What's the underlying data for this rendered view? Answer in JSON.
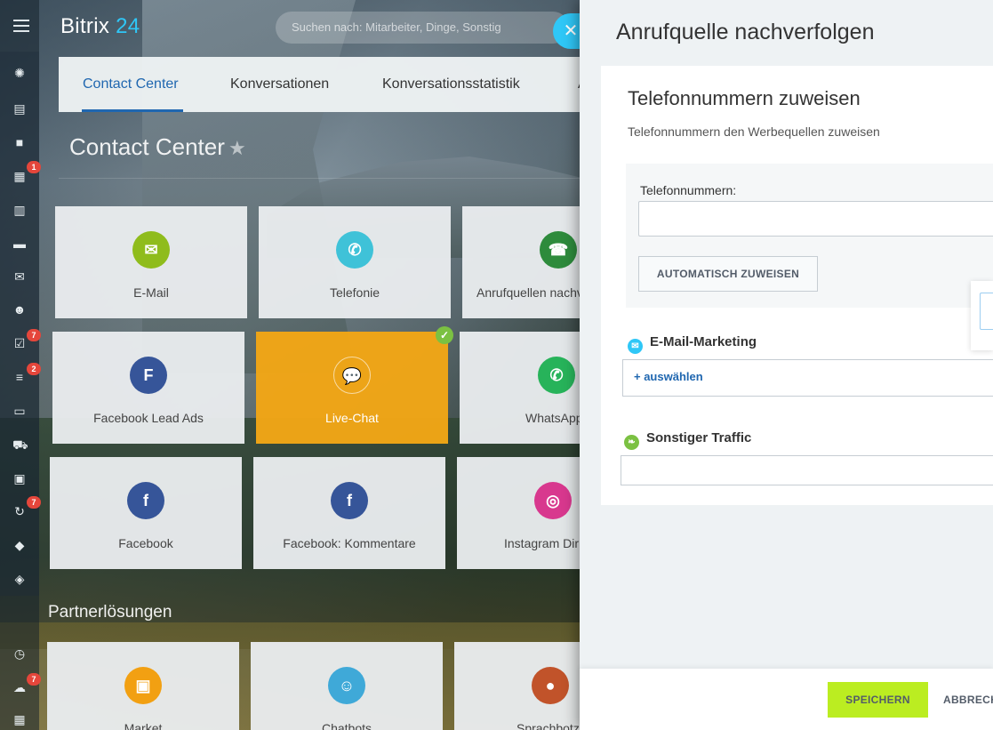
{
  "header": {
    "logo_text": "Bitrix",
    "logo_num": "24",
    "search_placeholder": "Suchen nach: Mitarbeiter, Dinge, Sonstig",
    "close_symbol": "✕"
  },
  "rail": {
    "badges": [
      "1",
      "7",
      "2",
      "7",
      "7"
    ]
  },
  "tabs": [
    {
      "label": "Contact Center",
      "active": true
    },
    {
      "label": "Konversationen",
      "active": false
    },
    {
      "label": "Konversationsstatistik",
      "active": false
    },
    {
      "label": "Ar",
      "active": false
    }
  ],
  "page": {
    "title": "Contact Center",
    "star": "★",
    "partner_title": "Partnerlösungen"
  },
  "tiles": [
    {
      "label": "E-Mail",
      "icon": "mail-icon",
      "glyph": "✉",
      "color": "#8fbc1c"
    },
    {
      "label": "Telefonie",
      "icon": "phone-icon",
      "glyph": "✆",
      "color": "#3fc2d8"
    },
    {
      "label": "Anrufquellen nachve",
      "icon": "phone-track-icon",
      "glyph": "☎",
      "color": "#2e8b3c"
    },
    {
      "label": "Facebook Lead Ads",
      "icon": "facebook-leads-icon",
      "glyph": "F",
      "color": "#365599"
    },
    {
      "label": "Live-Chat",
      "icon": "chat-icon",
      "glyph": "💬",
      "color": "transparent"
    },
    {
      "label": "WhatsApp",
      "icon": "whatsapp-icon",
      "glyph": "✆",
      "color": "#27b35a"
    },
    {
      "label": "Facebook",
      "icon": "facebook-icon",
      "glyph": "f",
      "color": "#365599"
    },
    {
      "label": "Facebook: Kommentare",
      "icon": "facebook-comments-icon",
      "glyph": "f",
      "color": "#365599"
    },
    {
      "label": "Instagram Dir",
      "icon": "instagram-icon",
      "glyph": "◎",
      "color": "#d8388e"
    },
    {
      "label": "Market",
      "icon": "market-icon",
      "glyph": "▣",
      "color": "#f2a012"
    },
    {
      "label": "Chatbots",
      "icon": "chatbot-icon",
      "glyph": "☺",
      "color": "#3fa9d8"
    },
    {
      "label": "Sprachbotz",
      "icon": "mic-icon",
      "glyph": "●",
      "color": "#c1532a"
    }
  ],
  "check_symbol": "✓",
  "panel": {
    "title": "Anrufquelle nachverfolgen",
    "card_title": "Telefonnummern zuweisen",
    "card_subtitle": "Telefonnummern den Werbequellen zuweisen",
    "phone_label": "Telefonnummern:",
    "phone_value": "",
    "auto_button": "AUTOMATISCH ZUWEISEN",
    "sources": [
      {
        "name": "E-Mail-Marketing",
        "icon": "mail-icon",
        "color": "#2fc7f7",
        "action": "+  auswählen"
      },
      {
        "name": "Sonstiger Traffic",
        "icon": "leaf-icon",
        "color": "#7bc142",
        "action": ""
      }
    ],
    "save_button": "SPEICHERN",
    "cancel_button": "ABBRECH"
  }
}
